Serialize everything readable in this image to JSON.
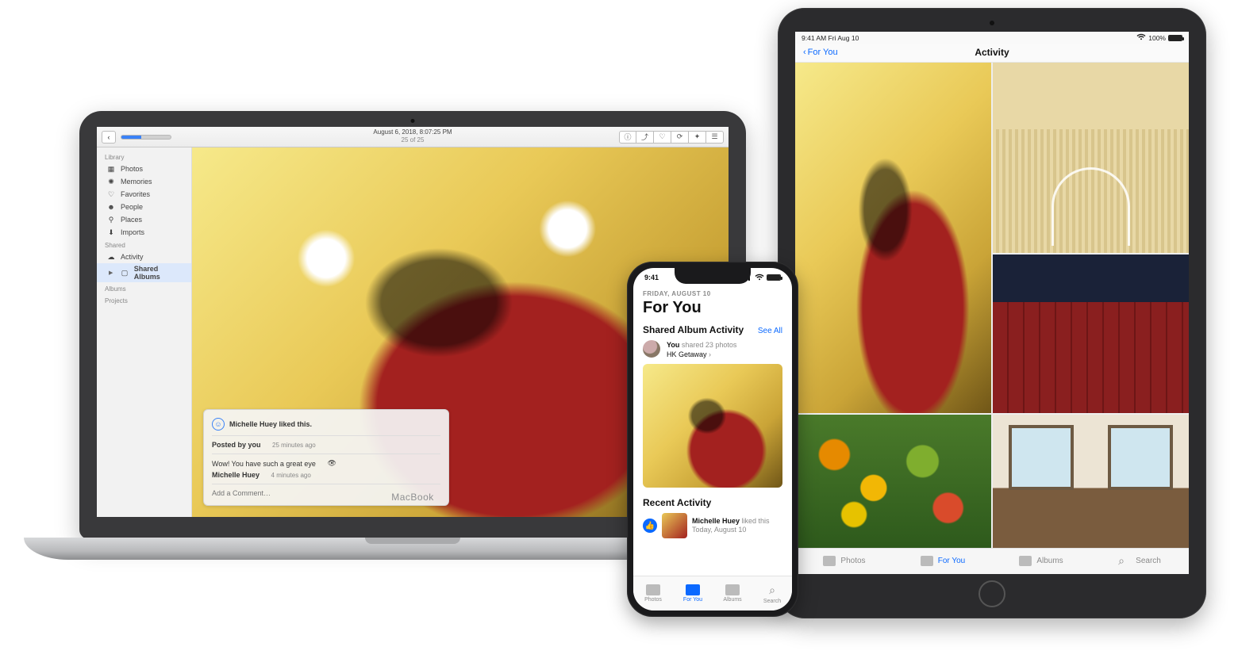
{
  "macbook": {
    "brand": "MacBook",
    "toolbar": {
      "title_line1": "August 6, 2018, 8:07:25 PM",
      "title_line2": "25 of 25",
      "buttons": {
        "info": "ⓘ",
        "share": "⤴",
        "favorite": "♡",
        "rotate": "⟳",
        "enhance": "✦",
        "edit": "☰"
      }
    },
    "sidebar": {
      "sections": [
        {
          "label": "Library",
          "items": [
            {
              "icon": "photos-icon",
              "label": "Photos"
            },
            {
              "icon": "memories-icon",
              "label": "Memories"
            },
            {
              "icon": "heart-icon",
              "label": "Favorites"
            },
            {
              "icon": "person-icon",
              "label": "People"
            },
            {
              "icon": "pin-icon",
              "label": "Places"
            },
            {
              "icon": "download-icon",
              "label": "Imports"
            }
          ]
        },
        {
          "label": "Shared",
          "items": [
            {
              "icon": "cloud-icon",
              "label": "Activity"
            },
            {
              "icon": "album-icon",
              "label": "Shared Albums",
              "selected": true,
              "disclosure": true
            }
          ]
        },
        {
          "label": "Albums",
          "items": []
        },
        {
          "label": "Projects",
          "items": []
        }
      ]
    },
    "overlay": {
      "liked_by": "Michelle Huey liked this.",
      "posted_label": "Posted by you",
      "posted_time": "25 minutes ago",
      "comment_text": "Wow! You have such a great eye",
      "comment_emoji": "👁",
      "comment_author": "Michelle Huey",
      "comment_time": "4 minutes ago",
      "add_placeholder": "Add a Comment…"
    }
  },
  "iphone": {
    "status_time": "9:41",
    "date_label": "FRIDAY, AUGUST 10",
    "title": "For You",
    "shared_heading": "Shared Album Activity",
    "see_all": "See All",
    "share_line1_strong": "You",
    "share_line1_rest": " shared 23 photos",
    "share_line2": "HK Getaway",
    "share_chevron": "›",
    "recent_heading": "Recent Activity",
    "recent_strong": "Michelle Huey",
    "recent_rest": " liked this",
    "recent_sub": "Today, August 10",
    "tabs": [
      {
        "label": "Photos"
      },
      {
        "label": "For You",
        "active": true
      },
      {
        "label": "Albums"
      },
      {
        "label": "Search"
      }
    ]
  },
  "ipad": {
    "status_left": "9:41 AM  Fri Aug 10",
    "status_right": "100%",
    "back_label": "For You",
    "title": "Activity",
    "tabs": [
      {
        "label": "Photos"
      },
      {
        "label": "For You",
        "active": true
      },
      {
        "label": "Albums"
      },
      {
        "label": "Search"
      }
    ]
  }
}
